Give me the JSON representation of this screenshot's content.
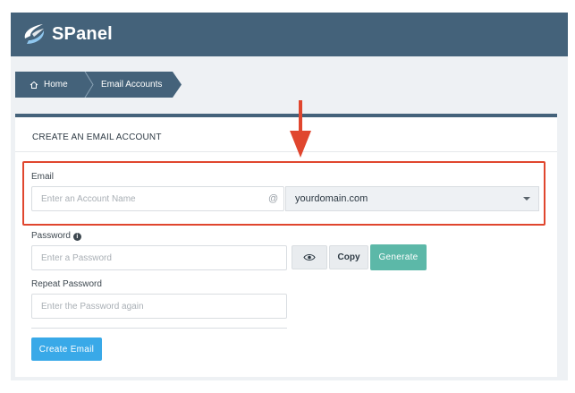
{
  "app": {
    "brand": "SPanel"
  },
  "breadcrumb": {
    "home": "Home",
    "current": "Email Accounts"
  },
  "panel": {
    "title": "CREATE AN EMAIL ACCOUNT"
  },
  "form": {
    "email_label": "Email",
    "account_placeholder": "Enter an Account Name",
    "at_sign": "@",
    "domain_value": "yourdomain.com",
    "password_label": "Password",
    "password_placeholder": "Enter a Password",
    "copy_label": "Copy",
    "generate_label": "Generate",
    "repeat_label": "Repeat Password",
    "repeat_placeholder": "Enter the Password again",
    "create_label": "Create Email"
  },
  "icons": {
    "home": "home-icon",
    "eye": "eye-icon",
    "info": "info-icon",
    "dropdown": "chevron-down-icon",
    "annotation": "red-arrow-down"
  },
  "colors": {
    "header": "#44627a",
    "generate": "#5cb8a8",
    "create": "#39a9e8",
    "highlight": "#e0462e"
  }
}
